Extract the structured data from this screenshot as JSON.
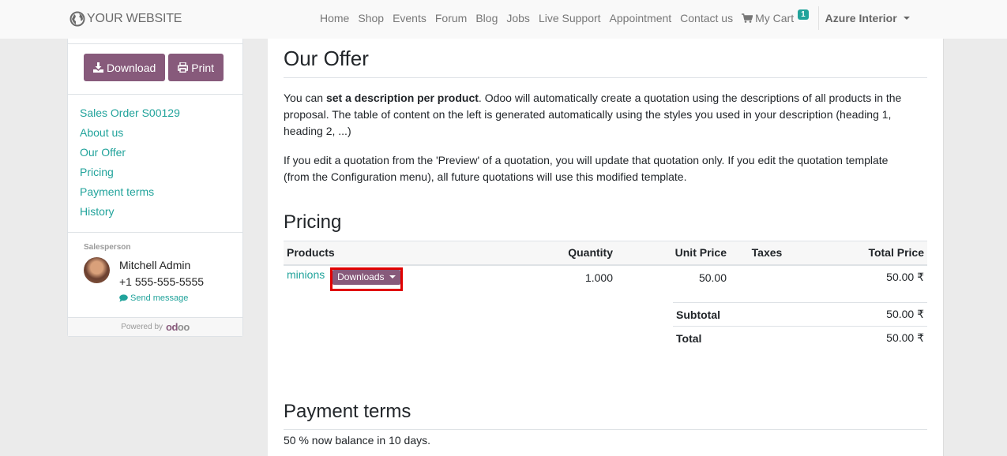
{
  "header": {
    "brand": "YOUR WEBSITE",
    "nav": [
      "Home",
      "Shop",
      "Events",
      "Forum",
      "Blog",
      "Jobs",
      "Live Support",
      "Appointment",
      "Contact us"
    ],
    "cart_label": "My Cart",
    "cart_count": "1",
    "user": "Azure Interior"
  },
  "sidebar": {
    "download_label": "Download",
    "print_label": "Print",
    "toc": [
      "Sales Order S00129",
      "About us",
      "Our Offer",
      "Pricing",
      "Payment terms",
      "History"
    ],
    "salesperson_label": "Salesperson",
    "salesperson_name": "Mitchell Admin",
    "salesperson_phone": "+1 555-555-5555",
    "send_message": "Send message",
    "powered_by": "Powered by",
    "powered_logo_a": "od",
    "powered_logo_b": "oo"
  },
  "main": {
    "offer_title": "Our Offer",
    "offer_p1_pre": "You can ",
    "offer_p1_bold": "set a description per product",
    "offer_p1_post": ". Odoo will automatically create a quotation using the descriptions of all products in the proposal. The table of content on the left is generated automatically using the styles you used in your description (heading 1, heading 2, ...)",
    "offer_p2": "If you edit a quotation from the 'Preview' of a quotation, you will update that quotation only. If you edit the quotation template (from the Configuration menu), all future quotations will use this modified template.",
    "pricing_title": "Pricing",
    "table": {
      "headers": [
        "Products",
        "Quantity",
        "Unit Price",
        "Taxes",
        "Total Price"
      ],
      "rows": [
        {
          "product": "minions",
          "downloads_label": "Downloads",
          "quantity": "1.000",
          "unit_price": "50.00",
          "taxes": "",
          "total": "50.00 ₹"
        }
      ]
    },
    "totals": [
      {
        "label": "Subtotal",
        "value": "50.00 ₹"
      },
      {
        "label": "Total",
        "value": "50.00 ₹"
      }
    ],
    "payment_title": "Payment terms",
    "payment_text": "50 % now balance in 10 days."
  },
  "colors": {
    "accent": "#21a39b",
    "brand_purple": "#875a7b",
    "highlight_box": "#e00000"
  }
}
